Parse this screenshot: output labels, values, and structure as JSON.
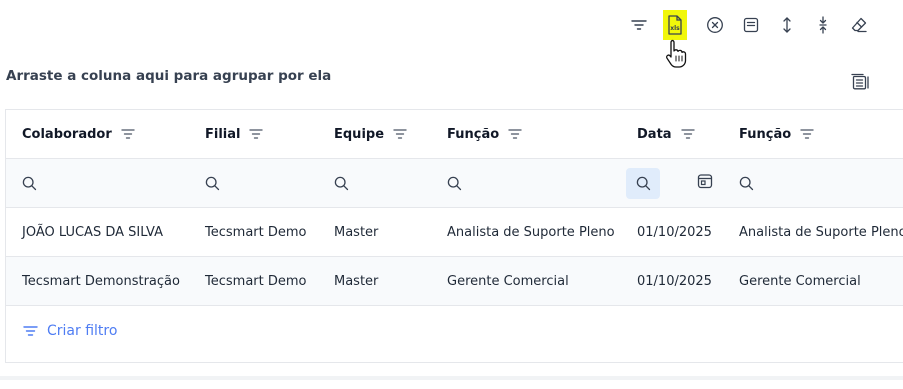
{
  "toolbar": {
    "buttons": [
      {
        "name": "filter-icon"
      },
      {
        "name": "xls-export-icon"
      },
      {
        "name": "clear-icon"
      },
      {
        "name": "notes-icon"
      },
      {
        "name": "expand-rows-icon"
      },
      {
        "name": "collapse-rows-icon"
      },
      {
        "name": "eraser-icon"
      }
    ],
    "active_color": "#f1f70a",
    "xls_label": "xls"
  },
  "group_hint": "Arraste a coluna aqui para agrupar por ela",
  "columns": [
    "Colaborador",
    "Filial",
    "Equipe",
    "Função",
    "Data",
    "Função"
  ],
  "rows": [
    [
      "JOÃO LUCAS DA SILVA",
      "Tecsmart Demo",
      "Master",
      "Analista de Suporte Pleno",
      "01/10/2025",
      "Analista de Suporte Pleno"
    ],
    [
      "Tecsmart Demonstração",
      "Tecsmart Demo",
      "Master",
      "Gerente Comercial",
      "01/10/2025",
      "Gerente Comercial"
    ]
  ],
  "footer": {
    "create_filter": "Criar filtro"
  },
  "colors": {
    "link": "#4f7df3",
    "search_active_bg": "#e0ecfb"
  }
}
